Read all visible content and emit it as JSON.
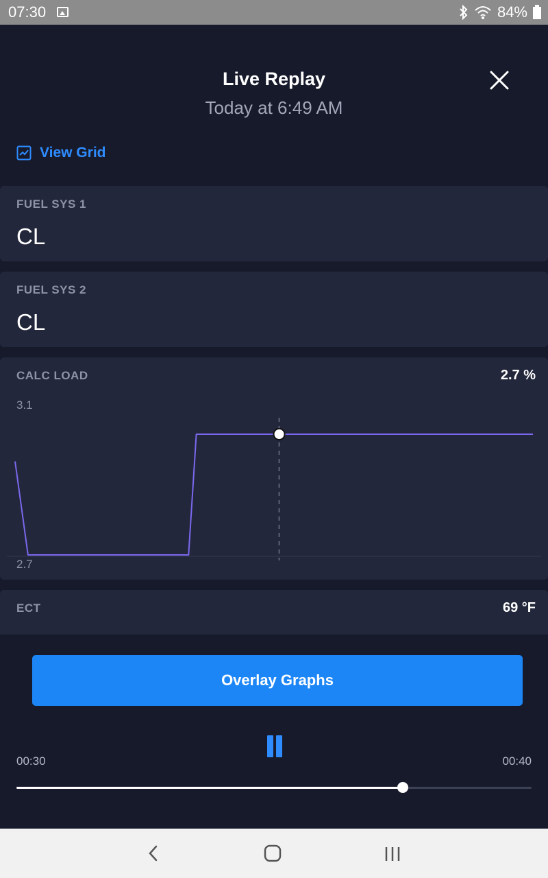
{
  "status_bar": {
    "time": "07:30",
    "battery": "84%"
  },
  "header": {
    "title": "Live Replay",
    "subtitle": "Today at 6:49 AM"
  },
  "view_grid_label": "View Grid",
  "cards": {
    "fuel_sys_1": {
      "label": "FUEL SYS 1",
      "value": "CL"
    },
    "fuel_sys_2": {
      "label": "FUEL SYS 2",
      "value": "CL"
    },
    "calc_load": {
      "label": "CALC LOAD",
      "value": "2.7 %",
      "axis_max": "3.1",
      "axis_min": "2.7"
    },
    "ect": {
      "label": "ECT",
      "value": "69 °F"
    }
  },
  "chart_data": {
    "type": "line",
    "title": "CALC LOAD",
    "xlabel": "",
    "ylabel": "",
    "ylim": [
      2.7,
      3.1
    ],
    "x": [
      0,
      0.025,
      0.05,
      0.1,
      0.2,
      0.3,
      0.32,
      0.335,
      0.35,
      0.4,
      0.5,
      0.6,
      0.7,
      0.8,
      0.9,
      1.0
    ],
    "series": [
      {
        "values": [
          3.01,
          2.7,
          2.7,
          2.7,
          2.7,
          2.7,
          2.7,
          2.7,
          3.1,
          3.1,
          3.1,
          3.1,
          3.1,
          3.1,
          3.1,
          3.1
        ]
      }
    ],
    "cursor_x": 0.51,
    "cursor_value": 3.1,
    "color": "#7b68ee"
  },
  "bottom": {
    "overlay_button": "Overlay Graphs",
    "time_start": "00:30",
    "time_end": "00:40",
    "progress": 0.75
  }
}
